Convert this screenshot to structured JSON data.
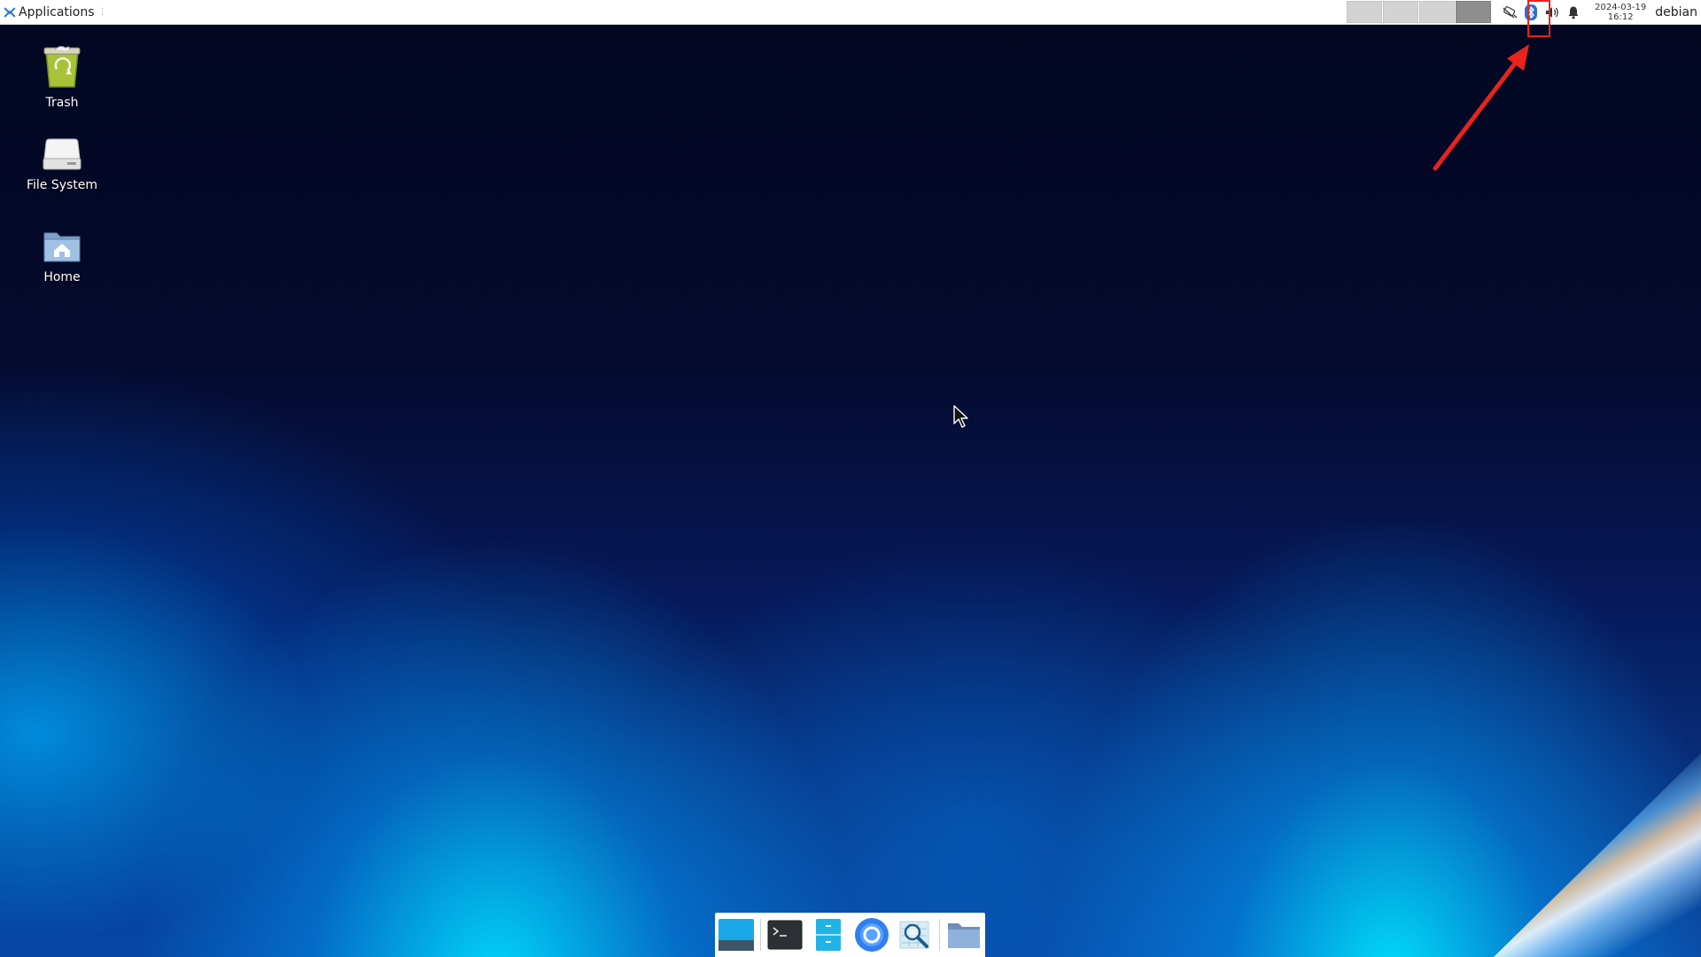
{
  "panel": {
    "applications_label": "Applications",
    "clock_date": "2024-03-19",
    "clock_time": "16:12",
    "user": "debian",
    "workspaces": 4,
    "active_workspace": 4,
    "tray_icons": [
      "network-disconnected-icon",
      "bluetooth-icon",
      "volume-icon",
      "notification-bell-icon"
    ]
  },
  "desktop": {
    "icons": [
      {
        "label": "Trash",
        "icon": "trash-icon"
      },
      {
        "label": "File System",
        "icon": "drive-icon"
      },
      {
        "label": "Home",
        "icon": "home-folder-icon"
      }
    ]
  },
  "dock": {
    "items": [
      "show-desktop-icon",
      "terminal-icon",
      "file-manager-icon",
      "web-browser-icon",
      "app-finder-icon",
      "folder-icon"
    ]
  },
  "colors": {
    "annotation": "#e8231c",
    "panel_bg": "#ffffff",
    "wallpaper_dark": "#040a2c",
    "wallpaper_light": "#00d8ff"
  }
}
